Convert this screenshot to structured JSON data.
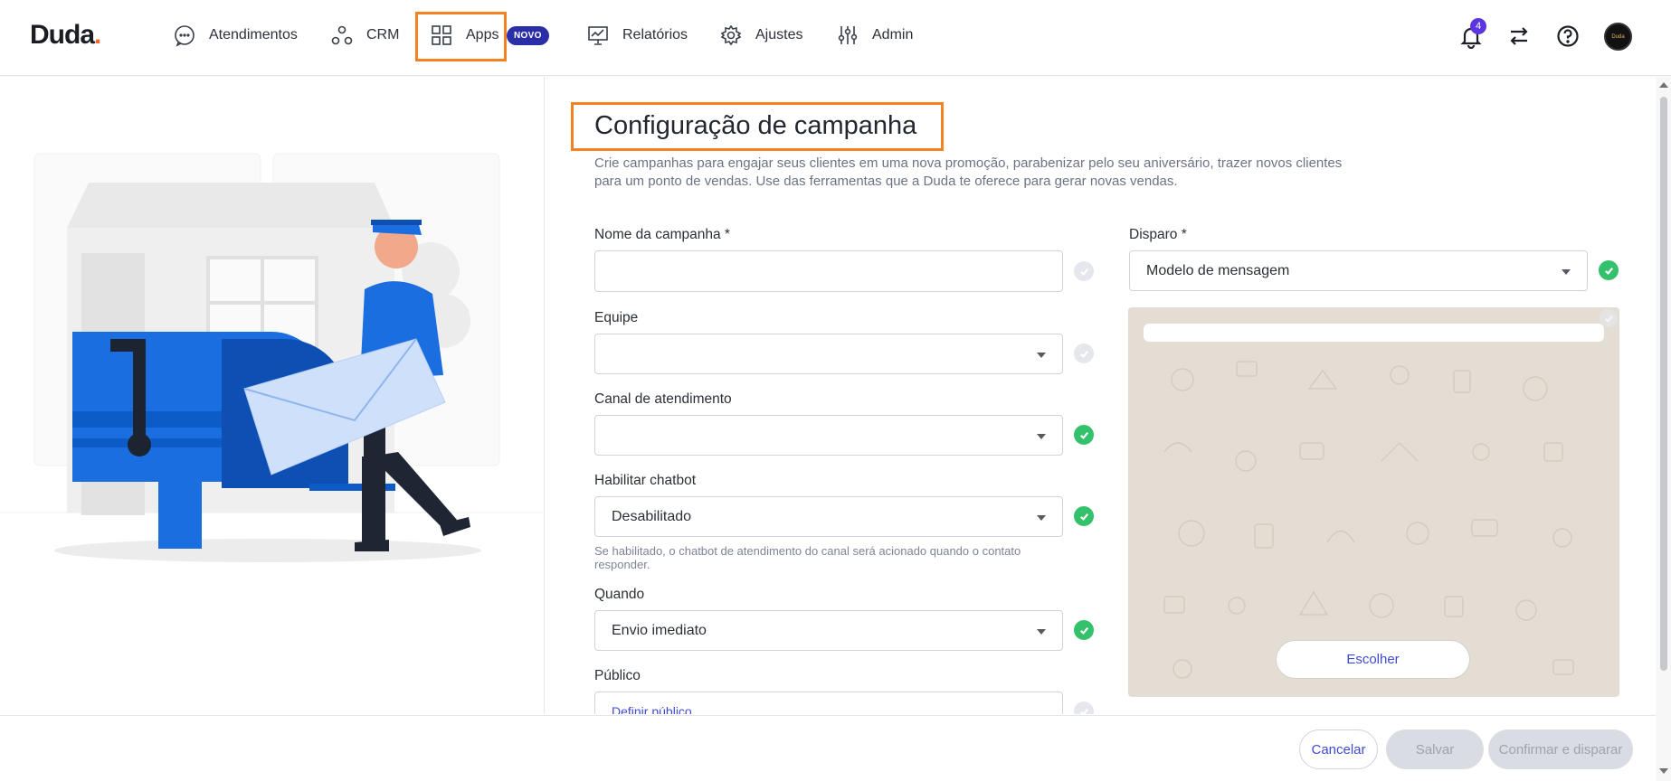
{
  "app": {
    "logo_text": "Duda",
    "logo_dot": ".",
    "accent": "#f26b2a",
    "brand_blue": "#2a2fa8"
  },
  "nav": {
    "items": [
      {
        "label": "Atendimentos",
        "icon": "chat-bubble-icon"
      },
      {
        "label": "CRM",
        "icon": "crm-nodes-icon"
      },
      {
        "label": "Apps",
        "icon": "apps-grid-icon"
      },
      {
        "label": "Relatórios",
        "icon": "presentation-chart-icon"
      },
      {
        "label": "Ajustes",
        "icon": "gear-icon"
      },
      {
        "label": "Admin",
        "icon": "sliders-icon"
      }
    ],
    "apps_badge": "NOVO"
  },
  "topright": {
    "notification_count": "4",
    "avatar_text": "Duda"
  },
  "page": {
    "title": "Configuração de campanha",
    "description": "Crie campanhas para engajar seus clientes em uma nova promoção, parabenizar pelo seu aniversário, trazer novos clientes para um ponto de vendas. Use das ferramentas que a Duda te oferece para gerar novas vendas."
  },
  "form": {
    "campaign_name": {
      "label": "Nome da campanha *",
      "value": ""
    },
    "team": {
      "label": "Equipe",
      "value": ""
    },
    "channel": {
      "label": "Canal de atendimento",
      "value": ""
    },
    "chatbot": {
      "label": "Habilitar chatbot",
      "value": "Desabilitado",
      "hint": "Se habilitado, o chatbot de atendimento do canal será acionado quando o contato responder."
    },
    "when": {
      "label": "Quando",
      "value": "Envio imediato"
    },
    "audience": {
      "label": "Público",
      "value": "Definir público"
    },
    "trigger": {
      "label": "Disparo *",
      "value": "Modelo de mensagem"
    }
  },
  "preview": {
    "choose_label": "Escolher"
  },
  "footer": {
    "cancel": "Cancelar",
    "save": "Salvar",
    "confirm": "Confirmar e disparar"
  }
}
